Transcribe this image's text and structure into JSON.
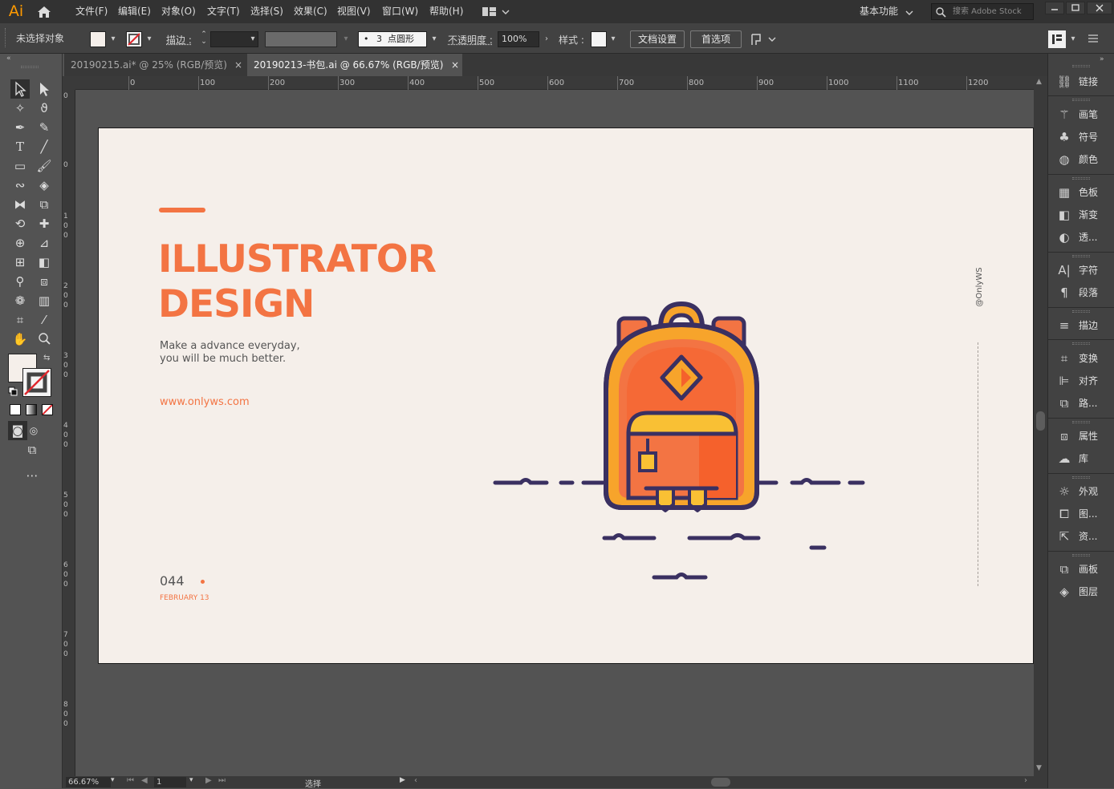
{
  "app": {
    "logo": "Ai",
    "menus": [
      "文件(F)",
      "编辑(E)",
      "对象(O)",
      "文字(T)",
      "选择(S)",
      "效果(C)",
      "视图(V)",
      "窗口(W)",
      "帮助(H)"
    ],
    "workspace": "基本功能",
    "search_placeholder": "搜索 Adobe Stock"
  },
  "control_bar": {
    "selection_status": "未选择对象",
    "stroke_label": "描边 :",
    "brush_size": "3",
    "brush_name": "点圆形",
    "opacity_label": "不透明度 :",
    "opacity_value": "100%",
    "style_label": "样式 :",
    "doc_setup_button": "文档设置",
    "preferences_button": "首选项"
  },
  "tabs": [
    {
      "label": "20190215.ai* @ 25% (RGB/预览)",
      "close": "×",
      "active": false
    },
    {
      "label": "20190213-书包.ai @ 66.67% (RGB/预览)",
      "close": "×",
      "active": true
    }
  ],
  "ruler_top": [
    "0",
    "100",
    "200",
    "300",
    "400",
    "500",
    "600",
    "700",
    "800",
    "900",
    "1000",
    "1100",
    "1200"
  ],
  "ruler_left": [
    "0",
    "0",
    "100",
    "200",
    "300",
    "400",
    "500",
    "600",
    "700",
    "800"
  ],
  "artboard": {
    "title_line1": "ILLUSTRATOR",
    "title_line2": "DESIGN",
    "subtitle_line1": "Make a advance everyday,",
    "subtitle_line2": "you will be much better.",
    "url": "www.onlyws.com",
    "number": "044",
    "date": "FEBRUARY 13",
    "vertical_tag": "@OnlyWS",
    "accent_color": "#f37443",
    "navy_color": "#3a3061"
  },
  "status_bar": {
    "zoom": "66.67%",
    "page": "1",
    "tool": "选择"
  },
  "right_panels": [
    {
      "label": "链接",
      "icon": "link-icon"
    },
    {
      "label": "画笔",
      "icon": "brush-icon"
    },
    {
      "label": "符号",
      "icon": "symbol-icon"
    },
    {
      "label": "颜色",
      "icon": "color-icon"
    },
    {
      "label": "色板",
      "icon": "swatches-icon"
    },
    {
      "label": "渐变",
      "icon": "gradient-icon"
    },
    {
      "label": "透...",
      "icon": "transparency-icon"
    },
    {
      "label": "字符",
      "icon": "character-icon"
    },
    {
      "label": "段落",
      "icon": "paragraph-icon"
    },
    {
      "label": "描边",
      "icon": "stroke-icon"
    },
    {
      "label": "变换",
      "icon": "transform-icon"
    },
    {
      "label": "对齐",
      "icon": "align-icon"
    },
    {
      "label": "路...",
      "icon": "pathfinder-icon"
    },
    {
      "label": "属性",
      "icon": "properties-icon"
    },
    {
      "label": "库",
      "icon": "libraries-icon"
    },
    {
      "label": "外观",
      "icon": "appearance-icon"
    },
    {
      "label": "图...",
      "icon": "graphic-styles-icon"
    },
    {
      "label": "资...",
      "icon": "asset-export-icon"
    },
    {
      "label": "画板",
      "icon": "artboards-icon"
    },
    {
      "label": "图层",
      "icon": "layers-icon"
    }
  ]
}
